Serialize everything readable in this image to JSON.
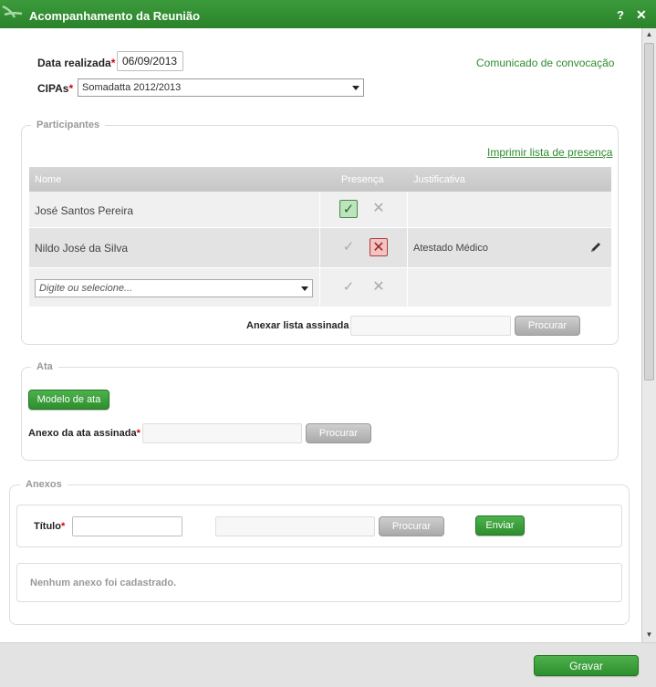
{
  "window": {
    "title": "Acompanhamento da Reunião",
    "help": "?",
    "close": "✕"
  },
  "form": {
    "data_label": "Data realizada",
    "data_value": "06/09/2013",
    "cipas_label": "CIPAs",
    "cipas_value": "Somadatta 2012/2013",
    "comunicado_link": "Comunicado de convocação"
  },
  "participantes": {
    "legend": "Participantes",
    "print_link": "Imprimir lista de presença",
    "columns": {
      "nome": "Nome",
      "presenca": "Presença",
      "justificativa": "Justificativa"
    },
    "rows": [
      {
        "nome": "José Santos Pereira",
        "presente": true,
        "ausente": false,
        "justificativa": ""
      },
      {
        "nome": "Nildo José da Silva",
        "presente": false,
        "ausente": true,
        "justificativa": "Atestado Médico"
      }
    ],
    "new_row_placeholder": "Digite ou selecione...",
    "anexar_label": "Anexar lista assinada",
    "procurar": "Procurar"
  },
  "ata": {
    "legend": "Ata",
    "modelo_button": "Modelo de ata",
    "anexo_label": "Anexo da ata assinada",
    "procurar": "Procurar"
  },
  "anexos": {
    "legend": "Anexos",
    "titulo_label": "Título",
    "procurar": "Procurar",
    "enviar": "Enviar",
    "empty_message": "Nenhum anexo foi cadastrado."
  },
  "footer": {
    "gravar": "Gravar"
  },
  "colors": {
    "accent": "#2e8b2e",
    "titlebar": "#2a822a",
    "required": "#d40000"
  }
}
